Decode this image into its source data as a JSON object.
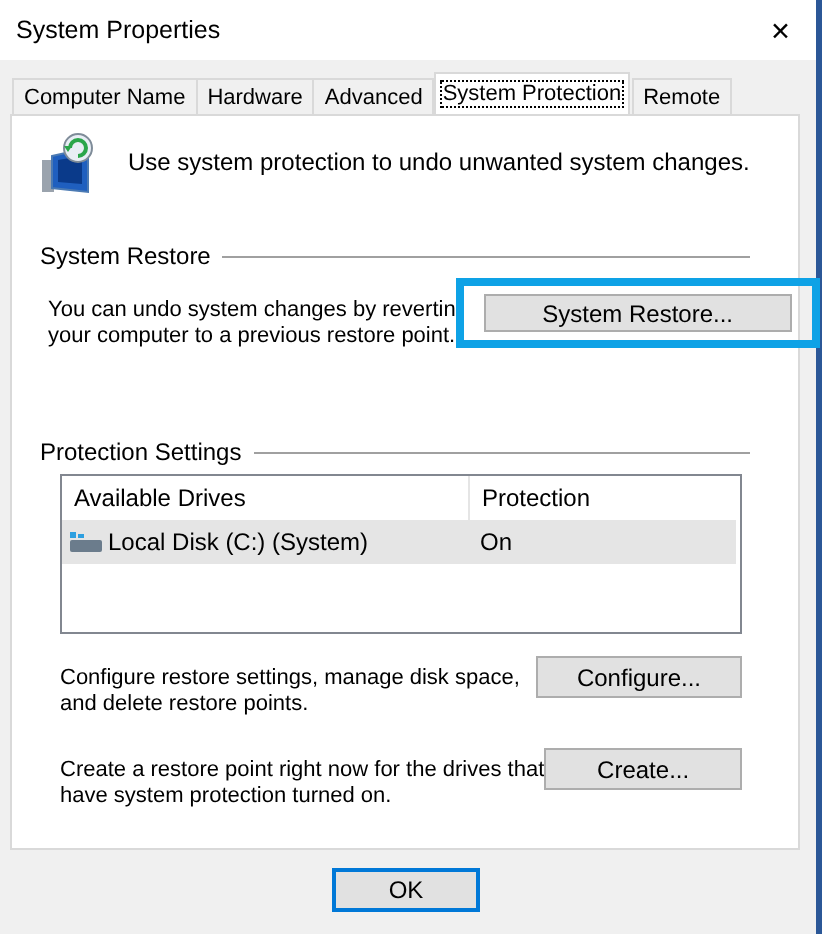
{
  "window": {
    "title": "System Properties",
    "close": "✕"
  },
  "tabs": [
    {
      "label": "Computer Name",
      "selected": false
    },
    {
      "label": "Hardware",
      "selected": false
    },
    {
      "label": "Advanced",
      "selected": false
    },
    {
      "label": "System Protection",
      "selected": true
    },
    {
      "label": "Remote",
      "selected": false
    }
  ],
  "intro": "Use system protection to undo unwanted system changes.",
  "system_restore": {
    "heading": "System Restore",
    "lines": [
      "You can undo system changes by revertin",
      "your computer to a previous restore point."
    ],
    "button": {
      "label": "System Restore...",
      "highlighted": true
    }
  },
  "protection_settings": {
    "heading": "Protection Settings",
    "columns": [
      "Available Drives",
      "Protection"
    ],
    "rows": [
      {
        "drive": "Local Disk (C:) (System)",
        "protection": "On",
        "selected": true
      }
    ],
    "actions": [
      {
        "lines": [
          "Configure restore settings, manage disk space,",
          "and delete restore points."
        ],
        "button": "Configure..."
      },
      {
        "lines": [
          "Create a restore point right now for the drives that",
          "have system protection turned on."
        ],
        "button": "Create..."
      }
    ]
  },
  "footer": {
    "buttons": [
      {
        "label": "OK",
        "default": true
      }
    ]
  }
}
